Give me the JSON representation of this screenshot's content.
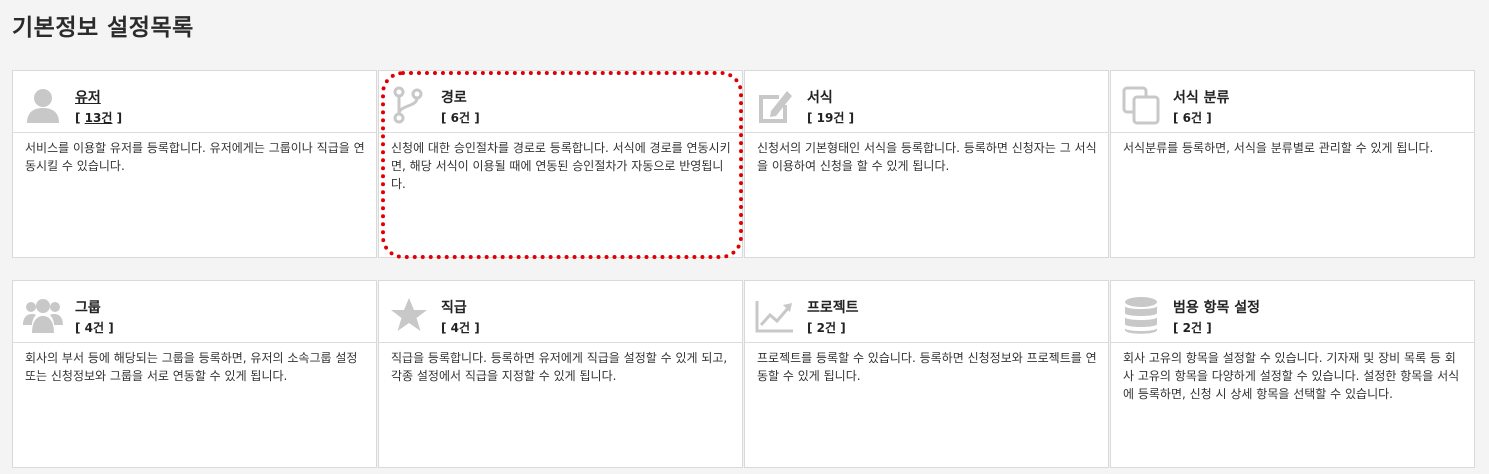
{
  "page": {
    "title": "기본정보 설정목록"
  },
  "cards": [
    {
      "title": "유저",
      "count": "13건",
      "desc": "서비스를 이용할 유저를 등록합니다. 유저에게는 그룹이나 직급을 연동시킬 수 있습니다.",
      "icon": "user-icon"
    },
    {
      "title": "경로",
      "count": "6건",
      "desc": "신청에 대한 승인절차를 경로로 등록합니다. 서식에 경로를 연동시키면, 해당 서식이 이용될 때에 연동된 승인절차가 자동으로 반영됩니다.",
      "icon": "branch-icon"
    },
    {
      "title": "서식",
      "count": "19건",
      "desc": "신청서의 기본형태인 서식을 등록합니다. 등록하면 신청자는 그 서식을 이용하여 신청을 할 수 있게 됩니다.",
      "icon": "edit-form-icon"
    },
    {
      "title": "서식 분류",
      "count": "6건",
      "desc": "서식분류를 등록하면, 서식을 분류별로 관리할 수 있게 됩니다.",
      "icon": "copy-icon"
    },
    {
      "title": "그룹",
      "count": "4건",
      "desc": "회사의 부서 등에 해당되는 그룹을 등록하면, 유저의 소속그룹 설정 또는 신청정보와 그룹을 서로 연동할 수 있게 됩니다.",
      "icon": "group-icon"
    },
    {
      "title": "직급",
      "count": "4건",
      "desc": "직급을 등록합니다. 등록하면 유저에게 직급을 설정할 수 있게 되고, 각종 설정에서 직급을 지정할 수 있게 됩니다.",
      "icon": "star-icon"
    },
    {
      "title": "프로젝트",
      "count": "2건",
      "desc": "프로젝트를 등록할 수 있습니다. 등록하면 신청정보와 프로젝트를 연동할 수 있게 됩니다.",
      "icon": "chart-line-icon"
    },
    {
      "title": "범용 항목 설정",
      "count": "2건",
      "desc": "회사 고유의 항목을 설정할 수 있습니다. 기자재 및 장비 목록 등 회사 고유의 항목을 다양하게 설정할 수 있습니다. 설정한 항목을 서식에 등록하면, 신청 시 상세 항목을 선택할 수 있습니다.",
      "icon": "database-icon"
    }
  ],
  "colors": {
    "icon": "#c8c8c8",
    "highlight": "#e00000"
  }
}
